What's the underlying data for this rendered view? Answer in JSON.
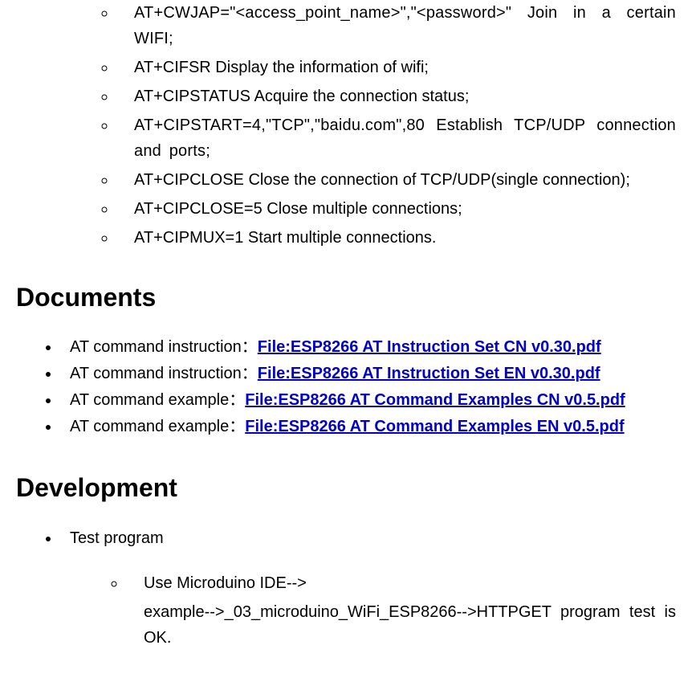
{
  "at_items": [
    "AT+CWJAP=\"<access_point_name>\",\"<password>\" Join in a certain WIFI;",
    "AT+CIFSR Display the information of wifi;",
    "AT+CIPSTATUS Acquire the connection status;",
    "AT+CIPSTART=4,\"TCP\",\"baidu.com\",80 Establish TCP/UDP connection and ports;",
    "AT+CIPCLOSE Close the connection of TCP/UDP(single connection);",
    "AT+CIPCLOSE=5 Close multiple connections;",
    "AT+CIPMUX=1 Start multiple connections."
  ],
  "sections": {
    "documents_title": "Documents",
    "development_title": "Development"
  },
  "docs": [
    {
      "prefix": "AT command instruction：",
      "link": "File:ESP8266 AT Instruction Set CN v0.30.pdf"
    },
    {
      "prefix": "AT command instruction：",
      "link": "File:ESP8266 AT Instruction Set EN v0.30.pdf"
    },
    {
      "prefix": "AT command example：",
      "link": "File:ESP8266 AT Command Examples CN v0.5.pdf"
    },
    {
      "prefix": "AT command example：",
      "link": "File:ESP8266 AT Command Examples EN v0.5.pdf"
    }
  ],
  "dev": {
    "outer_item": "Test program",
    "inner_line1": "Use Microduino IDE-->",
    "inner_line2": "example-->_03_microduino_WiFi_ESP8266-->HTTPGET program test is OK."
  }
}
